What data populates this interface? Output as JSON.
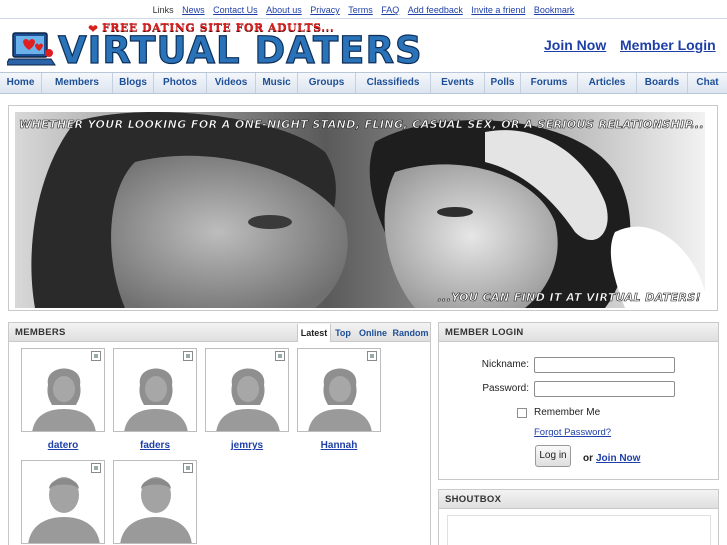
{
  "top_links": [
    "Links",
    "News",
    "Contact Us",
    "About us",
    "Privacy",
    "Terms",
    "FAQ",
    "Add feedback",
    "Invite a friend",
    "Bookmark"
  ],
  "header": {
    "tagline": "FREE DATING SITE FOR ADULTS...",
    "brand": "VIRTUAL DATERS",
    "join_label": "Join Now",
    "login_label": "Member Login"
  },
  "nav": [
    "Home",
    "Members",
    "Blogs",
    "Photos",
    "Videos",
    "Music",
    "Groups",
    "Classifieds",
    "Events",
    "Polls",
    "Forums",
    "Articles",
    "Boards",
    "Chat"
  ],
  "hero": {
    "top_caption": "WHETHER YOUR LOOKING FOR A ONE-NIGHT STAND, FLING, CASUAL SEX, OR A SERIOUS RELATIONSHIP...",
    "bottom_caption": "...YOU CAN FIND IT AT VIRTUAL DATERS!"
  },
  "members_panel": {
    "title": "MEMBERS",
    "tabs": [
      "Latest",
      "Top",
      "Online",
      "Random"
    ],
    "active_tab": "Latest",
    "members": [
      "datero",
      "faders",
      "jemrys",
      "Hannah",
      "",
      ""
    ]
  },
  "login_panel": {
    "title": "MEMBER LOGIN",
    "nickname_label": "Nickname:",
    "password_label": "Password:",
    "remember_label": "Remember Me",
    "forgot_label": "Forgot Password?",
    "login_button": "Log in",
    "or_label": "or",
    "join_label": "Join Now"
  },
  "shoutbox": {
    "title": "SHOUTBOX"
  },
  "colors": {
    "link": "#1f3fa8",
    "nav_text": "#1d4f97",
    "brand_blue": "#2a73b8",
    "tagline_red": "#e02020"
  }
}
